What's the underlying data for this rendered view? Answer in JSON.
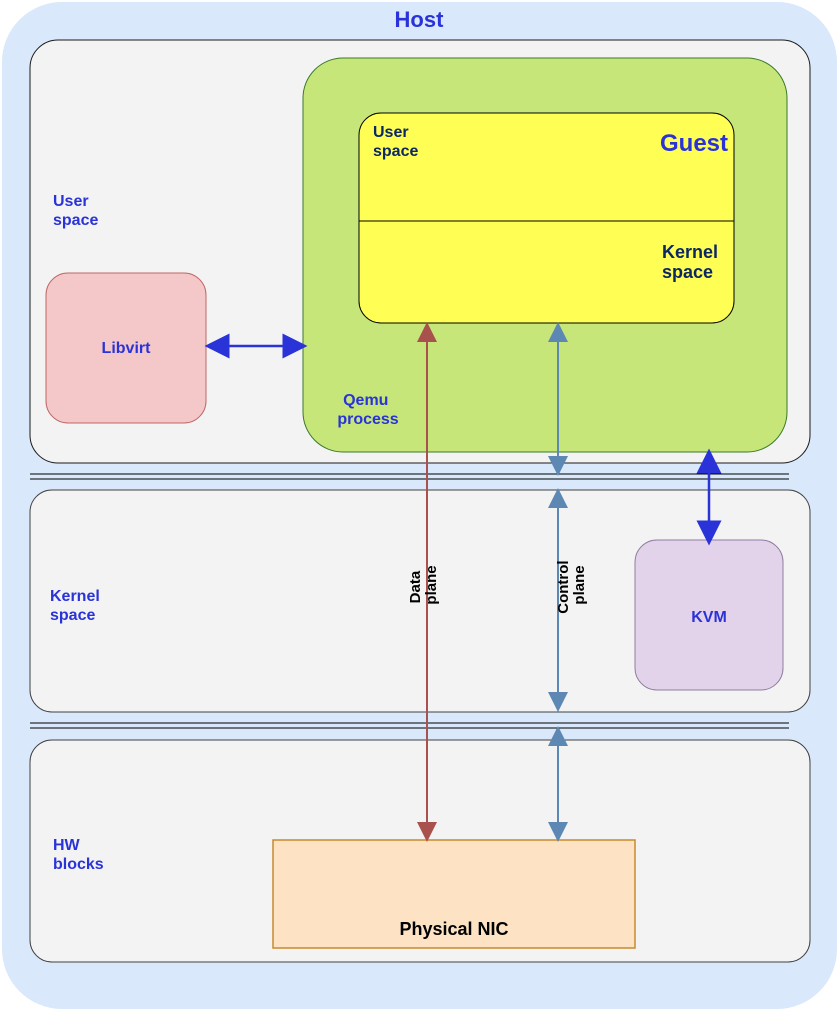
{
  "host": {
    "title": "Host",
    "user_space_label_l1": "User",
    "user_space_label_l2": "space",
    "kernel_space_label_l1": "Kernel",
    "kernel_space_label_l2": "space",
    "hw_blocks_label_l1": "HW",
    "hw_blocks_label_l2": "blocks"
  },
  "libvirt": {
    "label": "Libvirt"
  },
  "qemu": {
    "label_l1": "Qemu",
    "label_l2": "process"
  },
  "guest": {
    "title": "Guest",
    "user_space_l1": "User",
    "user_space_l2": "space",
    "kernel_space_l1": "Kernel",
    "kernel_space_l2": "space"
  },
  "kvm": {
    "label": "KVM"
  },
  "nic": {
    "label": "Physical NIC"
  },
  "arrows": {
    "data_plane_l1": "Data",
    "data_plane_l2": "plane",
    "control_plane_l1": "Control",
    "control_plane_l2": "plane"
  },
  "colors": {
    "host_bg": "#d9e8fb",
    "panel": "#f3f3f3",
    "qemu": "#c6e67a",
    "guest": "#fffe55",
    "libvirt": "#f4c7c8",
    "kvm": "#e2d2ea",
    "nic": "#fde3c4",
    "accent_blue": "#2a33d8",
    "navy": "#0b2764",
    "steel": "#5d88b3",
    "brick": "#a9514c"
  }
}
